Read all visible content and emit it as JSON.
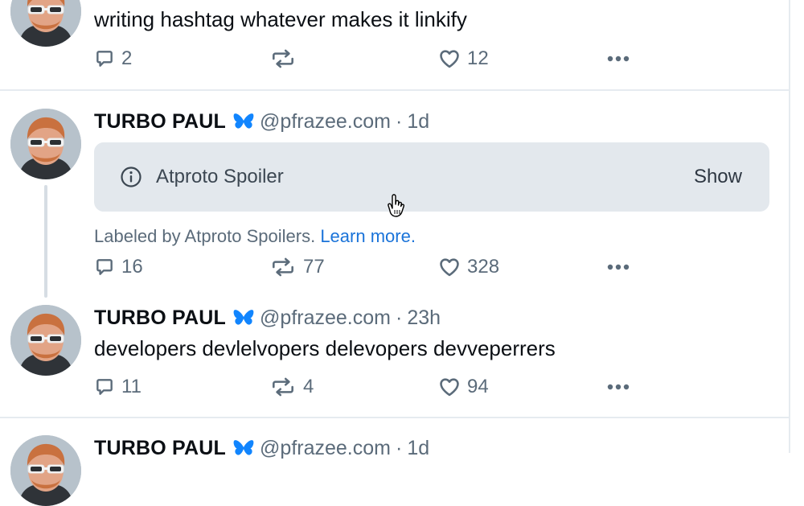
{
  "feed": {
    "posts": [
      {
        "text": "writing hashtag whatever makes it linkify",
        "reply_count": "2",
        "repost_count": "",
        "like_count": "12"
      },
      {
        "author_name": "TURBO PAUL",
        "author_handle": "@pfrazee.com",
        "separator": "·",
        "time": "1d",
        "spoiler": {
          "label": "Atproto Spoiler",
          "show_label": "Show"
        },
        "labeled_by_text": "Labeled by Atproto Spoilers.",
        "learn_more": "Learn more.",
        "reply_count": "16",
        "repost_count": "77",
        "like_count": "328"
      },
      {
        "author_name": "TURBO PAUL",
        "author_handle": "@pfrazee.com",
        "separator": "·",
        "time": "23h",
        "text": "developers devlelvopers delevopers devveperrers",
        "reply_count": "11",
        "repost_count": "4",
        "like_count": "94"
      },
      {
        "author_name": "TURBO PAUL",
        "author_handle": "@pfrazee.com",
        "separator": "·",
        "time": "1d"
      }
    ]
  },
  "colors": {
    "text": "#0b0f14",
    "muted": "#5b6b7a",
    "link": "#1a73d9",
    "spoiler_bg": "#e3e8ed",
    "butterfly": "#1185fe"
  },
  "icons": {
    "reply": "reply-icon",
    "repost": "repost-icon",
    "like": "heart-icon",
    "more": "more-icon",
    "info": "info-icon",
    "verified": "butterfly-icon",
    "cursor": "hand-cursor-icon"
  }
}
